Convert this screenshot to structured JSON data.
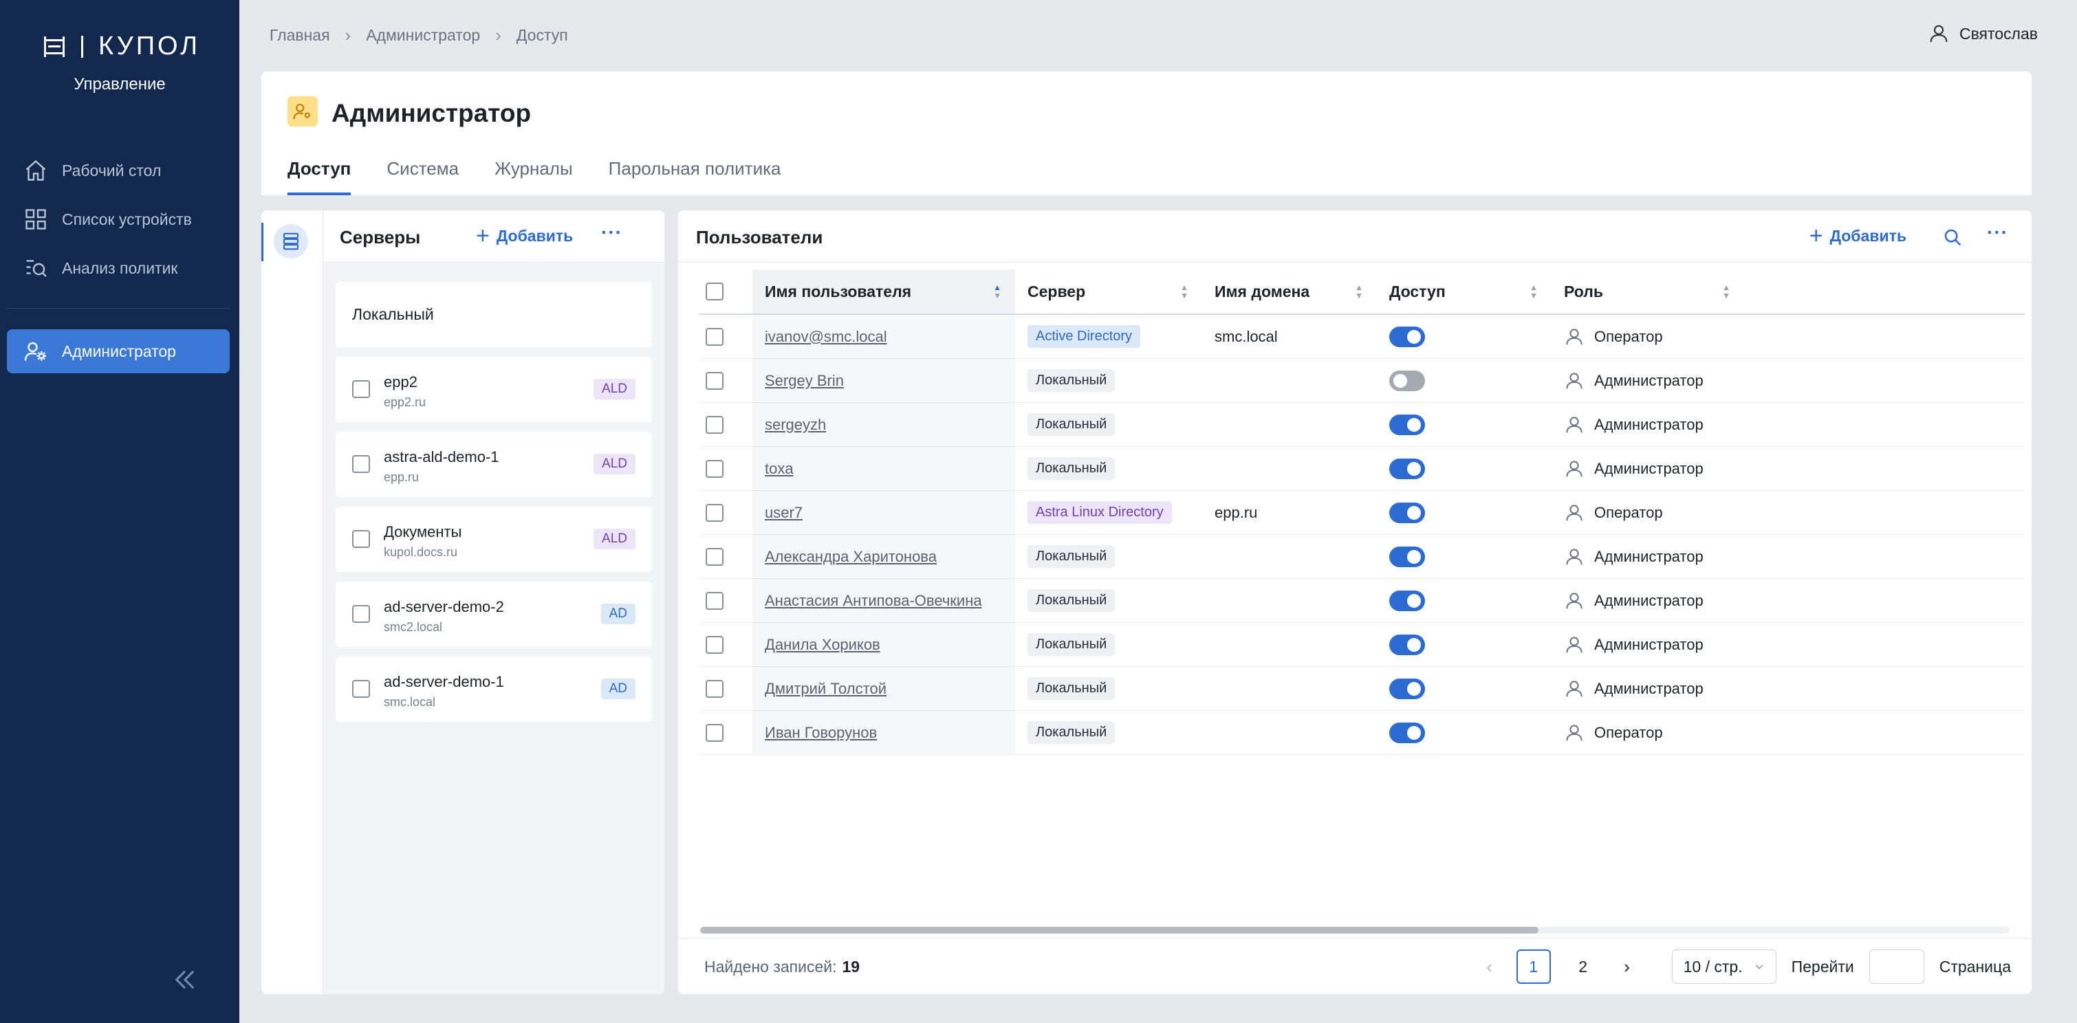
{
  "app": {
    "logo_text": "КУПОЛ",
    "subtitle": "Управление"
  },
  "nav": {
    "items": [
      {
        "label": "Рабочий стол",
        "icon": "home-icon"
      },
      {
        "label": "Список устройств",
        "icon": "grid-icon"
      },
      {
        "label": "Анализ политик",
        "icon": "search-list-icon"
      }
    ],
    "active": {
      "label": "Администратор",
      "icon": "admin-gear-icon"
    }
  },
  "breadcrumb": [
    "Главная",
    "Администратор",
    "Доступ"
  ],
  "user": {
    "name": "Святослав"
  },
  "page": {
    "title": "Администратор",
    "tabs": [
      "Доступ",
      "Система",
      "Журналы",
      "Парольная политика"
    ],
    "active_tab": "Доступ"
  },
  "servers": {
    "title": "Серверы",
    "add_label": "Добавить",
    "local_label": "Локальный",
    "items": [
      {
        "name": "epp2",
        "domain": "epp2.ru",
        "type": "ALD"
      },
      {
        "name": "astra-ald-demo-1",
        "domain": "epp.ru",
        "type": "ALD"
      },
      {
        "name": "Документы",
        "domain": "kupol.docs.ru",
        "type": "ALD"
      },
      {
        "name": "ad-server-demo-2",
        "domain": "smc2.local",
        "type": "AD"
      },
      {
        "name": "ad-server-demo-1",
        "domain": "smc.local",
        "type": "AD"
      }
    ]
  },
  "users": {
    "title": "Пользователи",
    "add_label": "Добавить",
    "columns": [
      "Имя пользователя",
      "Сервер",
      "Имя домена",
      "Доступ",
      "Роль"
    ],
    "rows": [
      {
        "name": "ivanov@smc.local",
        "server": "Active Directory",
        "server_type": "ad",
        "domain": "smc.local",
        "access": true,
        "role": "Оператор"
      },
      {
        "name": "Sergey Brin",
        "server": "Локальный",
        "server_type": "local",
        "domain": "",
        "access": false,
        "role": "Администратор"
      },
      {
        "name": "sergeyzh",
        "server": "Локальный",
        "server_type": "local",
        "domain": "",
        "access": true,
        "role": "Администратор"
      },
      {
        "name": "toxa",
        "server": "Локальный",
        "server_type": "local",
        "domain": "",
        "access": true,
        "role": "Администратор"
      },
      {
        "name": "user7",
        "server": "Astra Linux Directory",
        "server_type": "ald",
        "domain": "epp.ru",
        "access": true,
        "role": "Оператор"
      },
      {
        "name": "Александра Харитонова",
        "server": "Локальный",
        "server_type": "local",
        "domain": "",
        "access": true,
        "role": "Администратор"
      },
      {
        "name": "Анастасия Антипова-Овечкина",
        "server": "Локальный",
        "server_type": "local",
        "domain": "",
        "access": true,
        "role": "Администратор"
      },
      {
        "name": "Данила Хориков",
        "server": "Локальный",
        "server_type": "local",
        "domain": "",
        "access": true,
        "role": "Администратор"
      },
      {
        "name": "Дмитрий Толстой",
        "server": "Локальный",
        "server_type": "local",
        "domain": "",
        "access": true,
        "role": "Администратор"
      },
      {
        "name": "Иван Говорунов",
        "server": "Локальный",
        "server_type": "local",
        "domain": "",
        "access": true,
        "role": "Оператор"
      }
    ],
    "footer": {
      "found_label": "Найдено записей:",
      "found_count": "19",
      "pages": [
        "1",
        "2"
      ],
      "current_page": "1",
      "page_size": "10 / стр.",
      "goto_label": "Перейти",
      "page_label": "Страница"
    }
  },
  "colors": {
    "sidebar": "#12294d",
    "accent": "#2c6cd2",
    "active_nav": "#3a79d6"
  }
}
